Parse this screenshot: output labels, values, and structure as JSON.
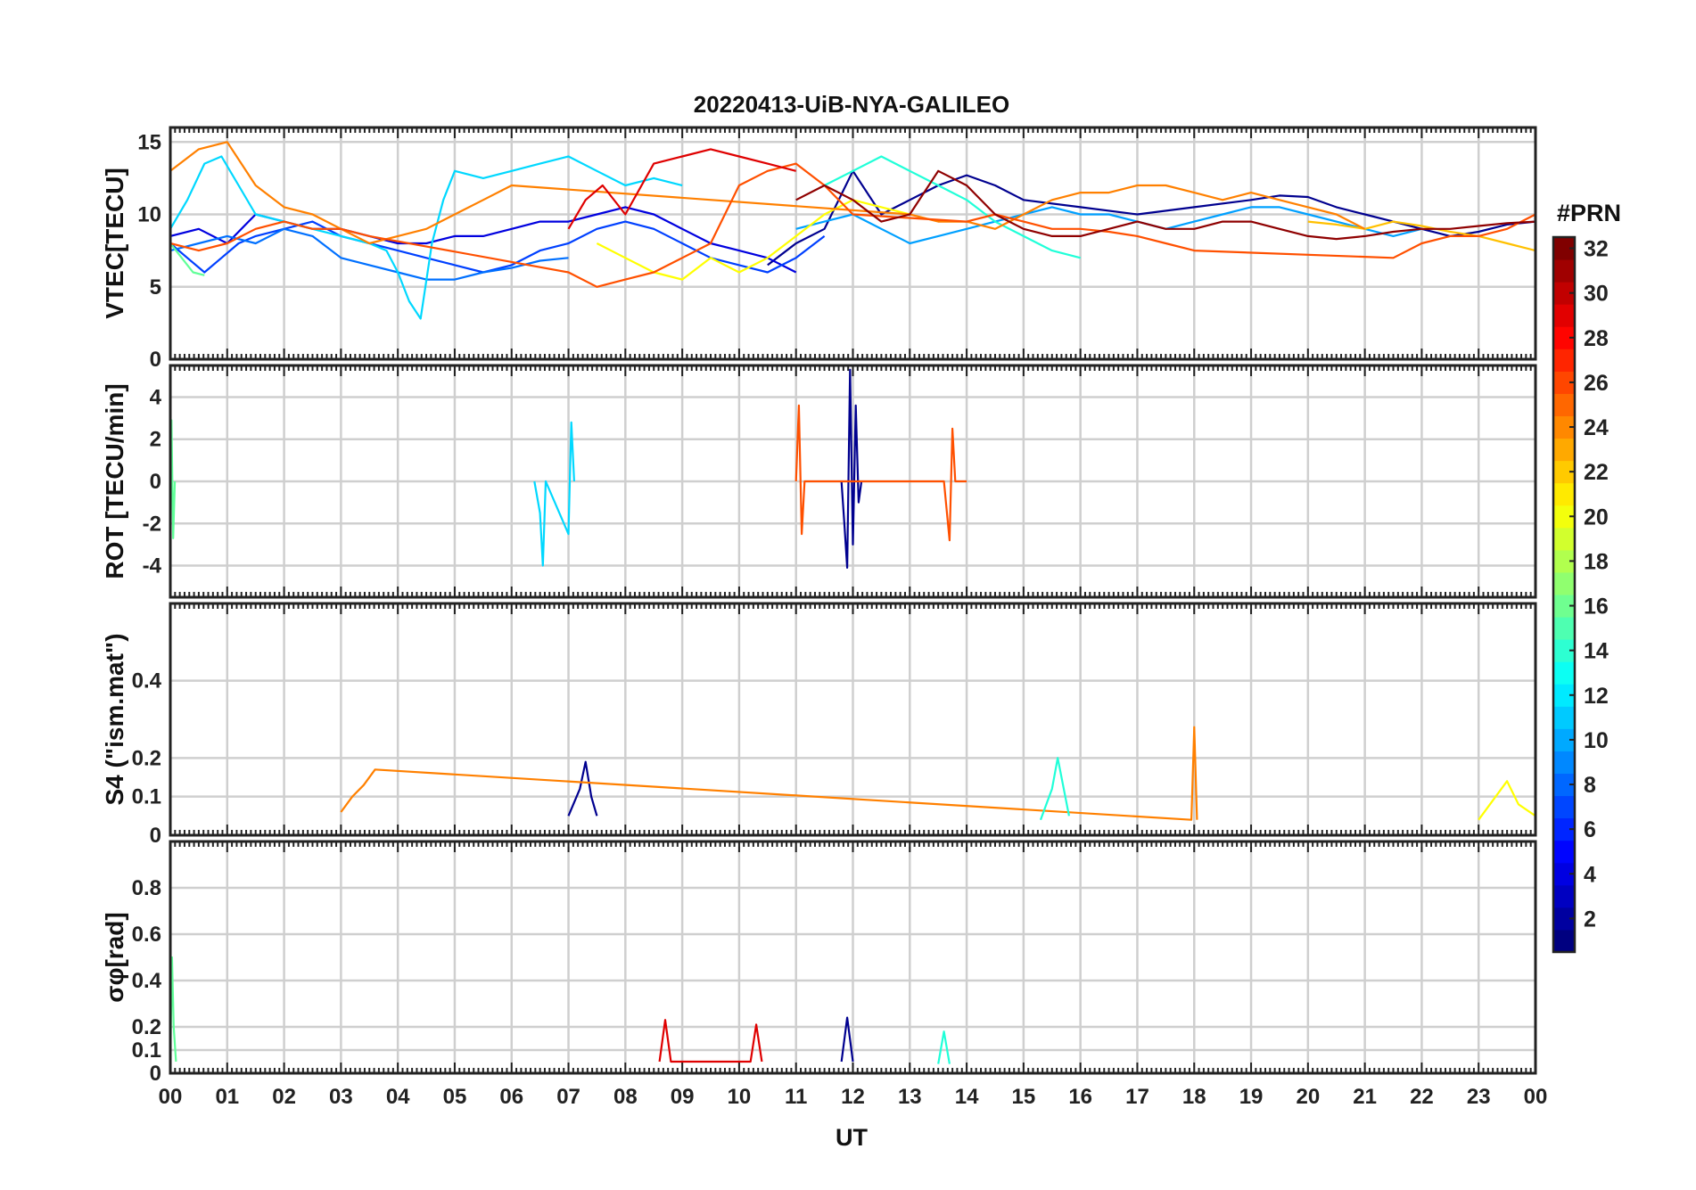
{
  "chart_data": {
    "type": "line",
    "title": "20220413-UiB-NYA-GALILEO",
    "xlabel": "UT",
    "x_ticks": [
      "00",
      "01",
      "02",
      "03",
      "04",
      "05",
      "06",
      "07",
      "08",
      "09",
      "10",
      "11",
      "12",
      "13",
      "14",
      "15",
      "16",
      "17",
      "18",
      "19",
      "20",
      "21",
      "22",
      "23",
      "00"
    ],
    "xlim": [
      0,
      24
    ],
    "grid": true,
    "colorbar": {
      "label": "#PRN",
      "range": [
        1,
        32
      ],
      "ticks": [
        "2",
        "4",
        "6",
        "8",
        "10",
        "12",
        "14",
        "16",
        "18",
        "20",
        "22",
        "24",
        "26",
        "28",
        "30",
        "32"
      ],
      "colormap": "jet"
    },
    "panels": [
      {
        "ylabel": "VTEC[TECU]",
        "ylim": [
          0,
          16
        ],
        "y_ticks": [
          "0",
          "5",
          "10",
          "15"
        ],
        "series": [
          {
            "prn": 2,
            "color": "#00008f",
            "x": [
              10.5,
              11,
              11.5,
              12,
              12.5,
              13,
              13.5,
              14,
              14.5,
              15,
              16,
              17,
              18,
              19,
              19.5,
              20,
              20.5,
              21,
              21.5,
              22,
              22.5,
              23,
              23.5,
              24
            ],
            "y": [
              6.5,
              8,
              9,
              13,
              10,
              11,
              12,
              12.7,
              12,
              11,
              10.5,
              10,
              10.5,
              11,
              11.3,
              11.2,
              10.5,
              10,
              9.5,
              9,
              8.5,
              8.8,
              9.3,
              9.5
            ]
          },
          {
            "prn": 4,
            "color": "#0000df",
            "x": [
              0,
              0.5,
              1,
              1.5,
              2,
              2.5,
              3,
              3.5,
              4,
              4.5,
              5,
              5.5,
              6,
              6.5,
              7,
              7.5,
              8,
              8.5,
              9,
              9.5,
              10,
              10.5,
              11
            ],
            "y": [
              8.5,
              9,
              8,
              10,
              9.5,
              9,
              9,
              8.5,
              8,
              8,
              8.5,
              8.5,
              9,
              9.5,
              9.5,
              10,
              10.5,
              10,
              9,
              8,
              7.5,
              7,
              6
            ]
          },
          {
            "prn": 6,
            "color": "#0040ff",
            "x": [
              0,
              0.3,
              0.6,
              0.9,
              1.2,
              1.5,
              2,
              2.5,
              3,
              3.5,
              4,
              4.5,
              5,
              5.5,
              6,
              6.5,
              7,
              7.5,
              8,
              8.5,
              9,
              9.5,
              10,
              10.5,
              11,
              11.5
            ],
            "y": [
              8,
              7,
              6,
              7,
              8,
              8.5,
              9,
              9.5,
              8.5,
              8,
              7.5,
              7,
              6.5,
              6,
              6.5,
              7.5,
              8,
              9,
              9.5,
              9,
              8,
              7,
              6.5,
              6,
              7,
              8.5
            ]
          },
          {
            "prn": 8,
            "color": "#0070ff",
            "x": [
              0,
              0.5,
              1,
              1.5,
              2,
              2.5,
              3,
              3.5,
              4,
              4.5,
              5,
              5.5,
              6,
              6.5,
              7
            ],
            "y": [
              7.5,
              8,
              8.5,
              8,
              9,
              8.5,
              7,
              6.5,
              6,
              5.5,
              5.5,
              6,
              6.3,
              6.8,
              7
            ]
          },
          {
            "prn": 10,
            "color": "#00a0ff",
            "x": [
              11,
              11.5,
              12,
              12.5,
              13,
              13.5,
              14,
              14.5,
              15,
              15.5,
              16,
              16.5,
              17,
              17.5,
              18,
              18.5,
              19,
              19.5,
              20,
              20.5,
              21,
              21.5,
              22
            ],
            "y": [
              9,
              9.5,
              10,
              9,
              8,
              8.5,
              9,
              9.5,
              10,
              10.5,
              10,
              10,
              9.5,
              9,
              9.5,
              10,
              10.5,
              10.5,
              10,
              9.5,
              9,
              8.5,
              9
            ]
          },
          {
            "prn": 12,
            "color": "#00d8ff",
            "x": [
              0,
              0.3,
              0.6,
              0.9,
              1.2,
              1.5,
              2,
              2.5,
              3,
              3.5,
              3.8,
              4,
              4.2,
              4.4,
              4.6,
              4.8,
              5,
              5.5,
              6,
              6.5,
              7,
              7.5,
              8,
              8.5,
              9
            ],
            "y": [
              9,
              11,
              13.5,
              14,
              12,
              10,
              9.5,
              9,
              8.5,
              8,
              7.5,
              6,
              4,
              2.8,
              8,
              11,
              13,
              12.5,
              13,
              13.5,
              14,
              13,
              12,
              12.5,
              12
            ]
          },
          {
            "prn": 14,
            "color": "#20ffd8",
            "x": [
              11.5,
              12,
              12.5,
              13,
              13.5,
              14,
              14.5,
              15,
              15.5,
              16
            ],
            "y": [
              12,
              13,
              14,
              13,
              12,
              11,
              9.5,
              8.5,
              7.5,
              7
            ]
          },
          {
            "prn": 16,
            "color": "#60ff98",
            "x": [
              0,
              0.2,
              0.4,
              0.6
            ],
            "y": [
              8,
              7,
              6,
              5.8
            ]
          },
          {
            "prn": 20,
            "color": "#ffff00",
            "x": [
              7.5,
              8,
              8.5,
              9,
              9.5,
              10,
              10.5,
              11,
              11.5,
              12,
              12.5,
              13
            ],
            "y": [
              8,
              7,
              6,
              5.5,
              7,
              6,
              7,
              8.5,
              10,
              11,
              10.5,
              10
            ]
          },
          {
            "prn": 22,
            "color": "#ffc000",
            "x": [
              20,
              20.5,
              21,
              21.5,
              22,
              22.5,
              23,
              23.5,
              24
            ],
            "y": [
              9.5,
              9.3,
              9,
              9.5,
              9.2,
              8.8,
              8.5,
              8,
              7.5
            ]
          },
          {
            "prn": 24,
            "color": "#ff8000",
            "x": [
              0,
              0.5,
              1,
              1.5,
              2,
              2.5,
              3,
              3.5,
              4,
              4.5,
              5,
              5.5,
              6,
              13,
              13.5,
              14,
              14.5,
              15,
              15.5,
              16,
              16.5,
              17,
              17.5,
              18,
              18.5,
              19,
              19.5,
              20,
              20.5,
              21
            ],
            "y": [
              13,
              14.5,
              15,
              12,
              10.5,
              10,
              9,
              8,
              8.5,
              9,
              10,
              11,
              12,
              10,
              9.5,
              9.5,
              9,
              10,
              11,
              11.5,
              11.5,
              12,
              12,
              11.5,
              11,
              11.5,
              11,
              10.5,
              10,
              9
            ]
          },
          {
            "prn": 26,
            "color": "#ff5000",
            "x": [
              0,
              0.5,
              1,
              1.5,
              2,
              2.5,
              3,
              3.5,
              7,
              7.5,
              8,
              8.5,
              9,
              9.5,
              10,
              10.5,
              11,
              11.5,
              12,
              14,
              14.5,
              15,
              15.5,
              16,
              16.5,
              17,
              17.5,
              18,
              21.5,
              22,
              22.5,
              23,
              23.5,
              24
            ],
            "y": [
              8,
              7.5,
              8,
              9,
              9.5,
              9,
              9,
              8.5,
              6,
              5,
              5.5,
              6,
              7,
              8,
              12,
              13,
              13.5,
              12,
              10,
              9.5,
              10,
              9.5,
              9,
              9,
              8.8,
              8.5,
              8,
              7.5,
              7,
              8,
              8.5,
              8.5,
              9,
              10
            ]
          },
          {
            "prn": 28,
            "color": "#df0000",
            "x": [
              7,
              7.3,
              7.6,
              8,
              8.5,
              9,
              9.5,
              10,
              10.5,
              11
            ],
            "y": [
              9,
              11,
              12,
              10,
              13.5,
              14,
              14.5,
              14,
              13.5,
              13
            ]
          },
          {
            "prn": 31,
            "color": "#8f0000",
            "x": [
              11,
              11.5,
              12,
              12.5,
              13,
              13.5,
              14,
              14.5,
              15,
              15.5,
              16,
              16.5,
              17,
              17.5,
              18,
              18.5,
              19,
              19.5,
              20,
              20.5,
              21,
              21.5,
              22,
              22.5,
              23,
              23.5,
              24
            ],
            "y": [
              11,
              12,
              11,
              9.5,
              10,
              13,
              12,
              10,
              9,
              8.5,
              8.5,
              9,
              9.5,
              9,
              9,
              9.5,
              9.5,
              9,
              8.5,
              8.3,
              8.5,
              8.8,
              9,
              9,
              9.2,
              9.4,
              9.5
            ]
          }
        ]
      },
      {
        "ylabel": "ROT [TECU/min]",
        "ylim": [
          -5.5,
          5.5
        ],
        "y_ticks": [
          "-4",
          "-2",
          "0",
          "2",
          "4"
        ],
        "series": [
          {
            "prn": 2,
            "color": "#00008f",
            "x": [
              11.8,
              11.85,
              11.9,
              11.95,
              12,
              12.05,
              12.1,
              12.15
            ],
            "y": [
              0,
              -2,
              -4.1,
              5.3,
              -3,
              3.6,
              -1,
              0
            ]
          },
          {
            "prn": 12,
            "color": "#00d8ff",
            "x": [
              6.4,
              6.5,
              6.55,
              6.6,
              7,
              7.05,
              7.1
            ],
            "y": [
              0,
              -1.5,
              -4,
              0,
              -2.5,
              2.8,
              0
            ]
          },
          {
            "prn": 26,
            "color": "#ff5000",
            "x": [
              11,
              11.05,
              11.1,
              11.15,
              13.6,
              13.7,
              13.75,
              13.8,
              14
            ],
            "y": [
              0,
              3.6,
              -2.5,
              0,
              0,
              -2.8,
              2.5,
              0,
              0
            ]
          },
          {
            "prn": 16,
            "color": "#60ff98",
            "x": [
              0,
              0.02,
              0.05,
              0.08
            ],
            "y": [
              0,
              2.9,
              -2.7,
              0
            ]
          }
        ]
      },
      {
        "ylabel": "S4 (\"ism.mat\")",
        "ylim": [
          0,
          0.6
        ],
        "y_ticks": [
          "0",
          "0.1",
          "0.2",
          "0.4"
        ],
        "series": [
          {
            "prn": 2,
            "color": "#00008f",
            "x": [
              7,
              7.2,
              7.3,
              7.4,
              7.5
            ],
            "y": [
              0.05,
              0.12,
              0.19,
              0.1,
              0.05
            ]
          },
          {
            "prn": 24,
            "color": "#ff8000",
            "x": [
              3,
              3.2,
              3.4,
              3.6,
              17.95,
              18,
              18.05
            ],
            "y": [
              0.06,
              0.1,
              0.13,
              0.17,
              0.04,
              0.28,
              0.04
            ]
          },
          {
            "prn": 14,
            "color": "#20ffd8",
            "x": [
              15.3,
              15.5,
              15.6,
              15.8
            ],
            "y": [
              0.04,
              0.12,
              0.2,
              0.05
            ]
          },
          {
            "prn": 20,
            "color": "#ffff00",
            "x": [
              23,
              23.3,
              23.5,
              23.7,
              24
            ],
            "y": [
              0.04,
              0.1,
              0.14,
              0.08,
              0.05
            ]
          }
        ]
      },
      {
        "ylabel": "σφ[rad]",
        "ylim": [
          0,
          1
        ],
        "y_ticks": [
          "0",
          "0.1",
          "0.2",
          "0.4",
          "0.6",
          "0.8"
        ],
        "series": [
          {
            "prn": 16,
            "color": "#60ff98",
            "x": [
              0,
              0.03,
              0.06,
              0.1
            ],
            "y": [
              0.05,
              0.5,
              0.2,
              0.05
            ]
          },
          {
            "prn": 28,
            "color": "#df0000",
            "x": [
              8.6,
              8.7,
              8.8,
              10.2,
              10.3,
              10.4
            ],
            "y": [
              0.05,
              0.23,
              0.05,
              0.05,
              0.21,
              0.05
            ]
          },
          {
            "prn": 2,
            "color": "#00008f",
            "x": [
              11.8,
              11.9,
              12
            ],
            "y": [
              0.05,
              0.24,
              0.05
            ]
          },
          {
            "prn": 14,
            "color": "#20ffd8",
            "x": [
              13.5,
              13.6,
              13.7
            ],
            "y": [
              0.04,
              0.18,
              0.04
            ]
          }
        ]
      }
    ]
  }
}
